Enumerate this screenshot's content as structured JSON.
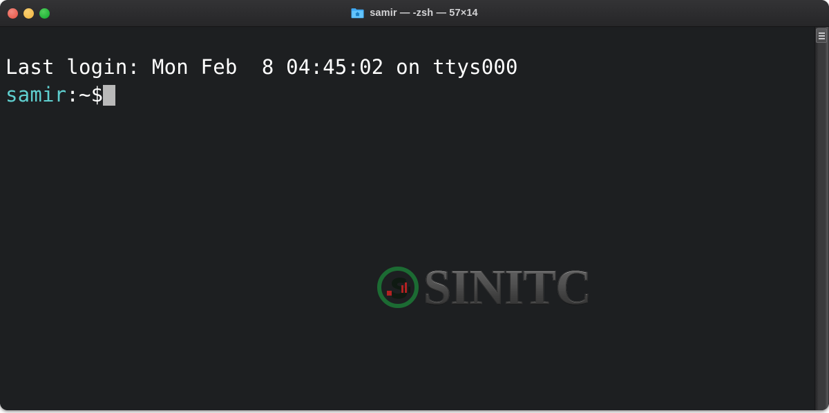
{
  "window": {
    "title": "samir — -zsh — 57×14",
    "title_icon": "home-folder-icon",
    "controls": {
      "close_label": "close",
      "minimize_label": "minimize",
      "maximize_label": "maximize"
    },
    "colors": {
      "close": "#ea6153",
      "minimize": "#f3bc4d",
      "maximize": "#23b43a",
      "titlebar_bg": "#2c2c2e",
      "terminal_bg": "#1d1f21",
      "prompt_user": "#5fcfcf",
      "text": "#ffffff",
      "cursor": "#b9b9b9",
      "page_bg": "#ffffff"
    }
  },
  "terminal": {
    "lines": [
      {
        "text": "Last login: Mon Feb  8 04:45:02 on ttys000"
      }
    ],
    "prompt": {
      "user": "samir",
      "separator": ":~$",
      "command": ""
    },
    "size": "57×14",
    "shell": "-zsh"
  },
  "scrollbar": {
    "name": "vertical-scrollbar",
    "thumb_position": "top"
  },
  "watermark": {
    "text": "SINITC",
    "logo_name": "sinitc-logo-icon",
    "logo_ring_color": "#1c6b33",
    "logo_accent_color": "#b22222"
  }
}
